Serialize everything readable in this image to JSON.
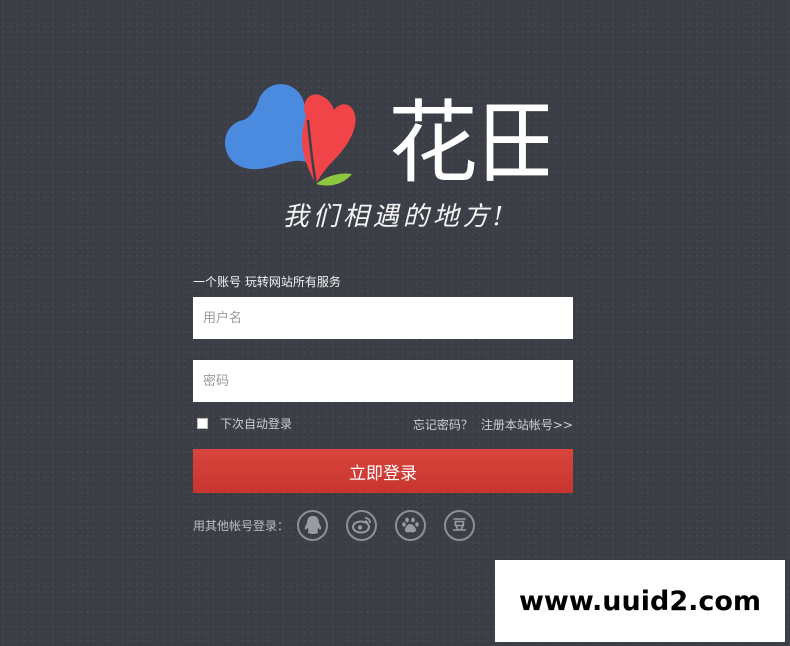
{
  "brand": {
    "name": "花田",
    "slogan": "我们相遇的地方!",
    "logo_icon": "flower-petals-icon",
    "colors": {
      "blue_petal": "#4a8be0",
      "red_petal": "#f04449",
      "leaf": "#8dc63f"
    }
  },
  "form": {
    "tagline": "一个账号 玩转网站所有服务",
    "username_placeholder": "用户名",
    "password_placeholder": "密码",
    "remember_label": "下次自动登录",
    "forgot_link": "忘记密码？",
    "register_link": "注册本站帐号>>",
    "submit_label": "立即登录",
    "submit_color": "#d13f37"
  },
  "social": {
    "label": "用其他帐号登录：",
    "providers": [
      {
        "name": "QQ",
        "icon": "qq-penguin-icon"
      },
      {
        "name": "Weibo",
        "icon": "weibo-icon"
      },
      {
        "name": "Baidu",
        "icon": "baidu-paw-icon"
      },
      {
        "name": "Douban",
        "icon": "douban-icon",
        "glyph": "豆"
      }
    ]
  },
  "watermark": {
    "text": "www.uuid2.com"
  }
}
